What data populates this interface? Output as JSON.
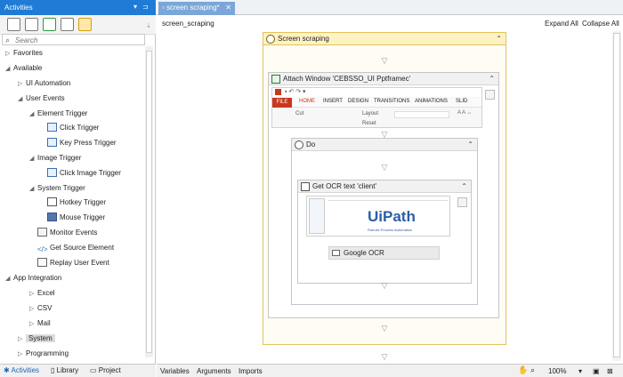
{
  "activities_panel": {
    "title": "Activities",
    "search_placeholder": "Search",
    "tree": [
      {
        "label": "Favorites",
        "arrow": "▷"
      },
      {
        "label": "Available",
        "arrow": "◢"
      },
      {
        "label": "UI Automation",
        "arrow": "▷"
      },
      {
        "label": "User Events",
        "arrow": "◢"
      },
      {
        "label": "Element Trigger",
        "arrow": "◢"
      },
      {
        "label": "Click Trigger",
        "arrow": ""
      },
      {
        "label": "Key Press Trigger",
        "arrow": ""
      },
      {
        "label": "Image Trigger",
        "arrow": "◢"
      },
      {
        "label": "Click Image Trigger",
        "arrow": ""
      },
      {
        "label": "System Trigger",
        "arrow": "◢"
      },
      {
        "label": "Hotkey Trigger",
        "arrow": ""
      },
      {
        "label": "Mouse Trigger",
        "arrow": ""
      },
      {
        "label": "Monitor Events",
        "arrow": ""
      },
      {
        "label": "Get Source Element",
        "arrow": ""
      },
      {
        "label": "Replay User Event",
        "arrow": ""
      },
      {
        "label": "App Integration",
        "arrow": "◢"
      },
      {
        "label": "Excel",
        "arrow": "▷"
      },
      {
        "label": "CSV",
        "arrow": "▷"
      },
      {
        "label": "Mail",
        "arrow": "▷"
      },
      {
        "label": "System",
        "arrow": "▷"
      },
      {
        "label": "Programming",
        "arrow": "▷"
      }
    ],
    "bottom_tabs": [
      "Activities",
      "Library",
      "Project"
    ]
  },
  "designer": {
    "tab_label": "screen scraping*",
    "breadcrumb": "screen_scraping",
    "expand_all": "Expand All",
    "collapse_all": "Collapse All",
    "sequence_title": "Screen scraping",
    "attach_title": "Attach Window 'CEBSSO_UI Pptframec'",
    "ribbon_tabs": [
      "FILE",
      "HOME",
      "INSERT",
      "DESIGN",
      "TRANSITIONS",
      "ANIMATIONS",
      "SLID"
    ],
    "ribbon_items": [
      "Cut",
      "Layout",
      "Reset"
    ],
    "do_title": "Do",
    "ocr_title": "Get OCR text 'client'",
    "logo_text": "UiPath",
    "logo_sub": "Robotic Process Automation",
    "ocr_engine": "Google OCR"
  },
  "status_bar": {
    "tabs": [
      "Variables",
      "Arguments",
      "Imports"
    ],
    "zoom": "100%"
  },
  "colors": {
    "accent": "#1f7bd6",
    "sequence_border": "#e2c25c",
    "ribbon_red": "#c9371f"
  }
}
